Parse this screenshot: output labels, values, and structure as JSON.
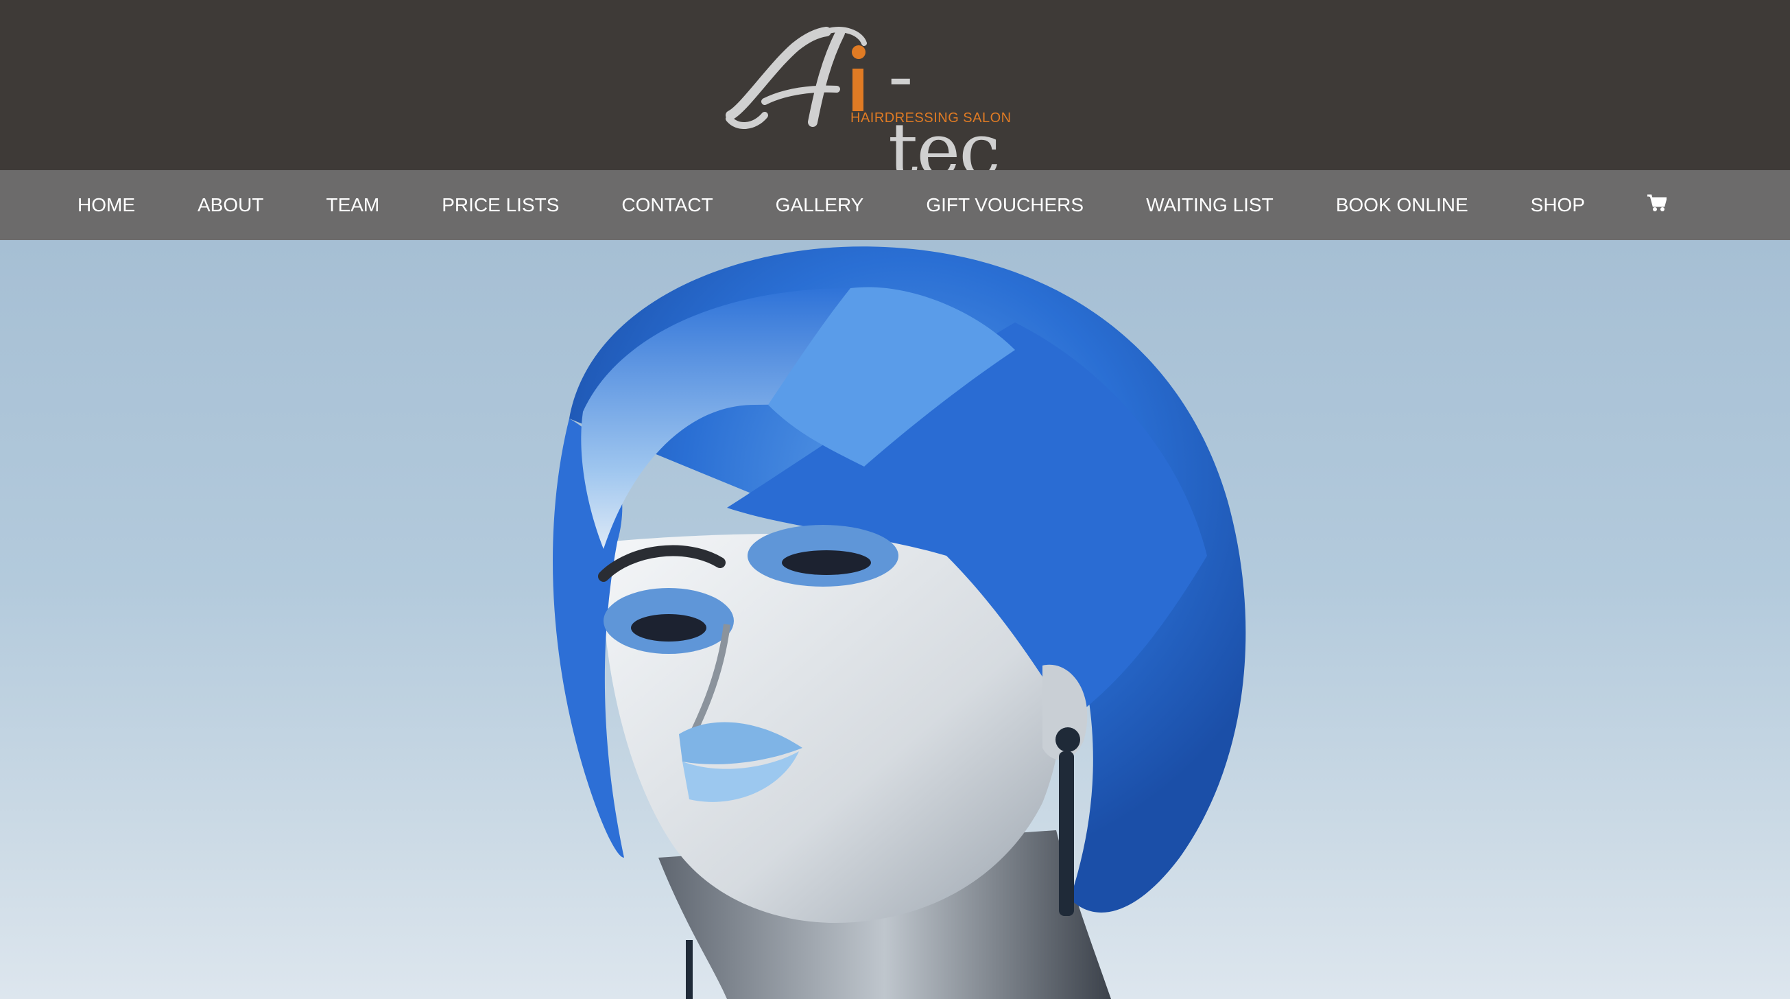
{
  "brand": {
    "logo_script": "Hi",
    "logo_word": "-tec",
    "tagline": "HAIRDRESSING SALON",
    "colors": {
      "header_bg": "#3e3a37",
      "nav_bg": "#6c6b6b",
      "accent_orange": "#e07b24",
      "logo_grey": "#d0d0d0"
    }
  },
  "nav": {
    "items": [
      {
        "label": "HOME"
      },
      {
        "label": "ABOUT"
      },
      {
        "label": "TEAM"
      },
      {
        "label": "PRICE LISTS"
      },
      {
        "label": "CONTACT"
      },
      {
        "label": "GALLERY"
      },
      {
        "label": "GIFT VOUCHERS"
      },
      {
        "label": "WAITING LIST"
      },
      {
        "label": "BOOK ONLINE"
      },
      {
        "label": "SHOP"
      }
    ],
    "cart_icon": "shopping-cart-icon"
  },
  "hero": {
    "image": "model-with-blue-bob-haircut"
  }
}
